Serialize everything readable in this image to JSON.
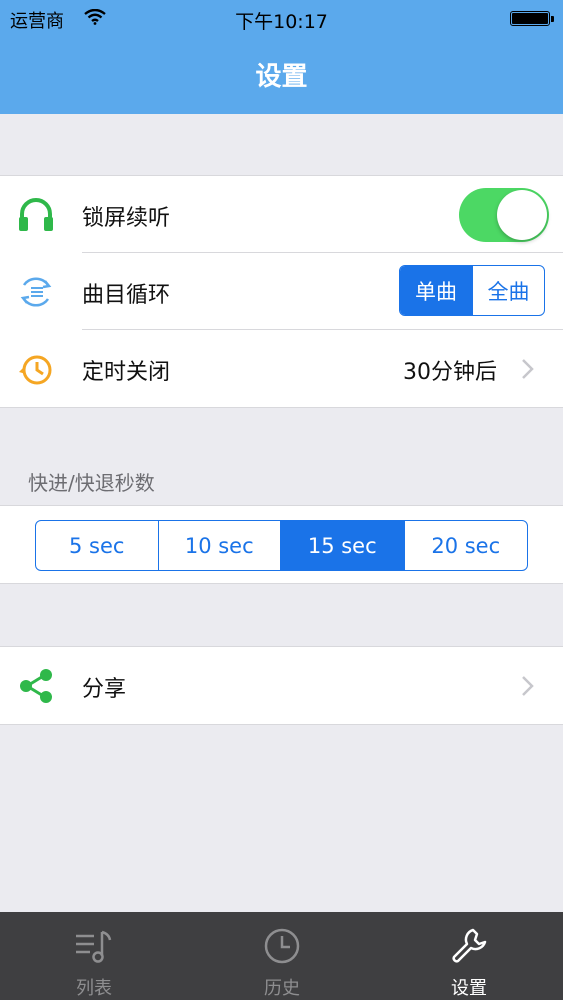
{
  "status_bar": {
    "carrier": "运营商",
    "time": "下午10:17"
  },
  "nav": {
    "title": "设置"
  },
  "settings": {
    "lock_listen": {
      "label": "锁屏续听",
      "enabled": true,
      "icon": "headphones-icon"
    },
    "loop": {
      "label": "曲目循环",
      "options": [
        "单曲",
        "全曲"
      ],
      "selected": "单曲",
      "icon": "repeat-list-icon"
    },
    "timer": {
      "label": "定时关闭",
      "value": "30分钟后",
      "icon": "timer-icon"
    }
  },
  "seek": {
    "header": "快进/快退秒数",
    "options": [
      "5 sec",
      "10 sec",
      "15 sec",
      "20 sec"
    ],
    "selected": "15 sec"
  },
  "share": {
    "label": "分享",
    "icon": "share-icon"
  },
  "tabs": [
    {
      "label": "列表",
      "icon": "playlist-icon",
      "active": false
    },
    {
      "label": "历史",
      "icon": "clock-icon",
      "active": false
    },
    {
      "label": "设置",
      "icon": "wrench-icon",
      "active": true
    }
  ],
  "colors": {
    "nav": "#5ba9ec",
    "accent": "#1a73e8",
    "toggle_on": "#4cd864",
    "icon_green": "#2fb84a",
    "timer_orange": "#f5a623",
    "tab_bar": "#3f3f41"
  }
}
